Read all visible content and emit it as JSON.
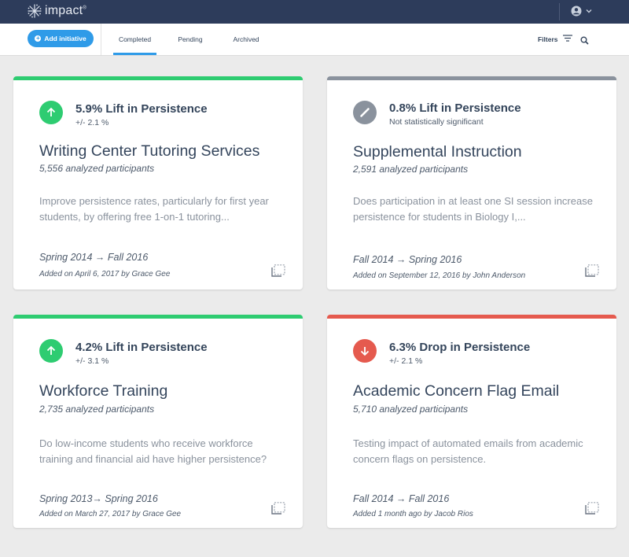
{
  "app": {
    "name": "impact",
    "trademark": "®"
  },
  "toolbar": {
    "add_label": "Add initiative",
    "tabs": [
      {
        "label": "Completed",
        "active": true
      },
      {
        "label": "Pending",
        "active": false
      },
      {
        "label": "Archived",
        "active": false
      }
    ],
    "filters_label": "Filters"
  },
  "colors": {
    "topbar": "#2d3c5b",
    "accent": "#2f9be8",
    "lift": "#2ecc71",
    "neutral": "#8a929d",
    "drop": "#e55a4e"
  },
  "cards": [
    {
      "status": "lift",
      "icon": "arrow-up-icon",
      "metric": "5.9% Lift in Persistence",
      "metric_sub": "+/- 2.1 %",
      "title": "Writing Center Tutoring Services",
      "participants": "5,556 analyzed participants",
      "description": "Improve persistence rates, particularly for first year students, by offering free 1-on-1 tutoring...",
      "dates": "Spring 2014 → Fall 2016",
      "added": "Added on April 6, 2017 by Grace Gee"
    },
    {
      "status": "neutral",
      "icon": "pencil-icon",
      "metric": "0.8% Lift in Persistence",
      "metric_sub": "Not statistically significant",
      "title": "Supplemental Instruction",
      "participants": "2,591 analyzed participants",
      "description": "Does participation in at least one SI session increase persistence for students in Biology I,...",
      "dates": "Fall 2014 → Spring 2016",
      "added": "Added on September 12,  2016 by John Anderson"
    },
    {
      "status": "lift",
      "icon": "arrow-up-icon",
      "metric": "4.2% Lift in Persistence",
      "metric_sub": "+/- 3.1 %",
      "title": "Workforce Training",
      "participants": "2,735 analyzed participants",
      "description": "Do low-income students who receive workforce training and financial aid have higher persistence?",
      "dates": "Spring 2013→ Spring 2016",
      "added": "Added on March 27, 2017 by Grace Gee"
    },
    {
      "status": "drop",
      "icon": "arrow-down-icon",
      "metric": "6.3% Drop in Persistence",
      "metric_sub": "+/- 2.1 %",
      "title": "Academic Concern Flag Email",
      "participants": "5,710 analyzed participants",
      "description": "Testing impact of automated emails from academic concern flags on persistence.",
      "dates": "Fall 2014 → Fall 2016",
      "added": "Added 1 month ago by Jacob Rios"
    }
  ]
}
